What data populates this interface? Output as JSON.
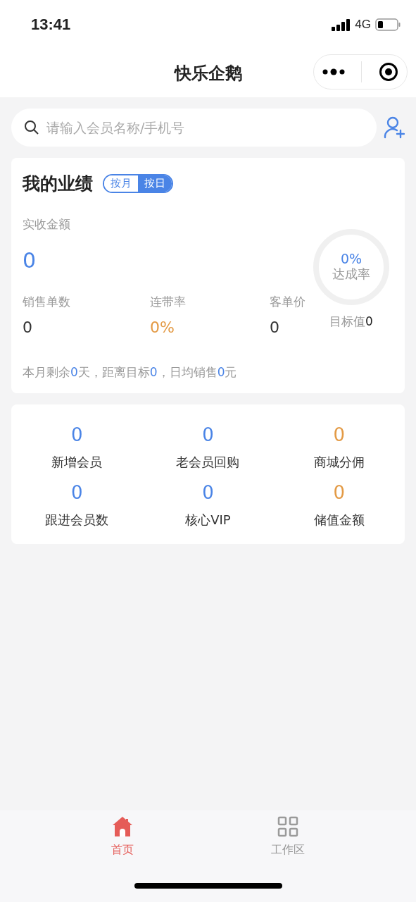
{
  "status_bar": {
    "time": "13:41",
    "network": "4G"
  },
  "nav": {
    "title": "快乐企鹅"
  },
  "search": {
    "placeholder": "请输入会员名称/手机号"
  },
  "performance": {
    "title": "我的业绩",
    "toggle": [
      {
        "label": "按月",
        "selected": false
      },
      {
        "label": "按日",
        "selected": true
      }
    ],
    "main_label": "实收金额",
    "main_value": "0",
    "metrics": [
      {
        "label": "销售单数",
        "value": "0",
        "color": "#333333"
      },
      {
        "label": "连带率",
        "value": "0%",
        "color": "#e39a45"
      },
      {
        "label": "客单价",
        "value": "0",
        "color": "#333333"
      }
    ],
    "ring": {
      "percent": "0%",
      "label": "达成率",
      "level": 0
    },
    "target_label": "目标值",
    "target_value": "0",
    "summary": [
      {
        "text": "本月剩余",
        "highlight": false
      },
      {
        "text": "0",
        "highlight": true
      },
      {
        "text": "天，距离目标",
        "highlight": false
      },
      {
        "text": "0",
        "highlight": true
      },
      {
        "text": "，日均销售",
        "highlight": false
      },
      {
        "text": "0",
        "highlight": true
      },
      {
        "text": "元",
        "highlight": false
      }
    ]
  },
  "stats": [
    {
      "value": "0",
      "label": "新增会员",
      "color": "#4a84e6"
    },
    {
      "value": "0",
      "label": "老会员回购",
      "color": "#4a84e6"
    },
    {
      "value": "0",
      "label": "商城分佣",
      "color": "#e39a45"
    },
    {
      "value": "0",
      "label": "跟进会员数",
      "color": "#4a84e6"
    },
    {
      "value": "0",
      "label": "核心VIP",
      "color": "#4a84e6"
    },
    {
      "value": "0",
      "label": "储值金额",
      "color": "#e39a45"
    }
  ],
  "tab_bar": [
    {
      "kind": "home",
      "label": "首页",
      "selected": true
    },
    {
      "kind": "grid",
      "label": "工作区",
      "selected": false
    }
  ]
}
